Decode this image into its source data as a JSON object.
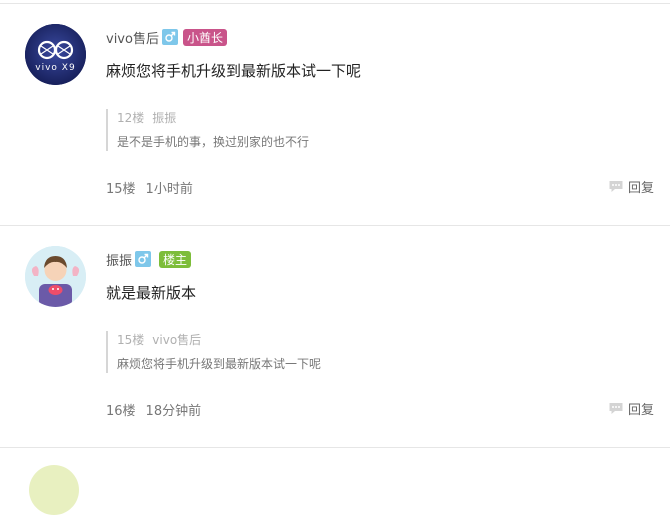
{
  "posts": [
    {
      "username": "vivo售后",
      "gender": "♂",
      "badge": "小酋长",
      "content": "麻烦您将手机升级到最新版本试一下呢",
      "quote": {
        "floor": "12楼",
        "author": "振振",
        "text": "是不是手机的事，换过别家的也不行"
      },
      "floor": "15楼",
      "time": "1小时前",
      "reply_label": "回复"
    },
    {
      "username": "振振",
      "gender": "♂",
      "badge": "楼主",
      "content": "就是最新版本",
      "quote": {
        "floor": "15楼",
        "author": "vivo售后",
        "text": "麻烦您将手机升级到最新版本试一下呢"
      },
      "floor": "16楼",
      "time": "18分钟前",
      "reply_label": "回复"
    }
  ],
  "colors": {
    "badge_chief": "#c9548a",
    "badge_owner": "#7dbd3a",
    "gender_male": "#7ec7ea",
    "divider": "#e6e6e6"
  },
  "icons": [
    "gender-male-icon",
    "reply-icon",
    "vivo-logo-avatar",
    "user-avatar"
  ]
}
